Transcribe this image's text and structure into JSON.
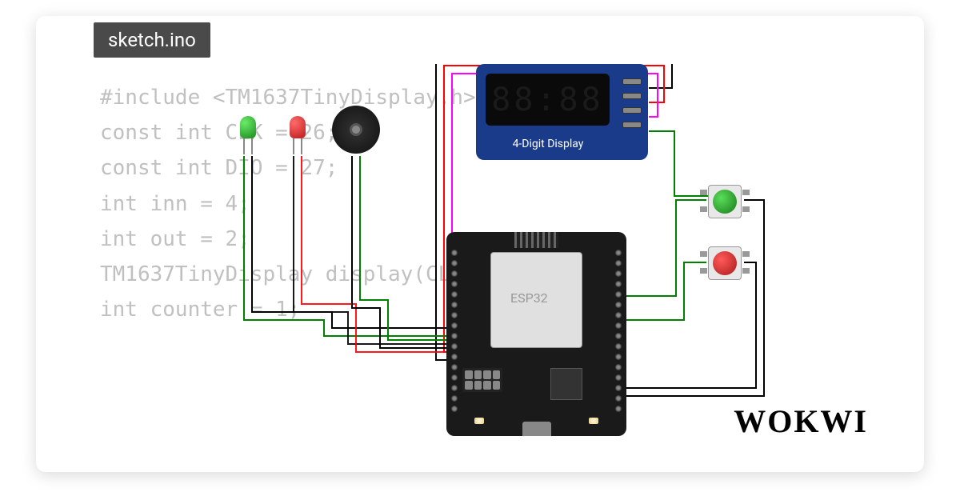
{
  "tab_name": "sketch.ino",
  "logo_text": "WOKWI",
  "code": {
    "line1": "#include <TM1637TinyDisplay.h>",
    "line2": "const int CLK = 26;",
    "line3": "const int DIO = 27;",
    "line4": "",
    "line5": "int inn = 4;",
    "line6": "int out = 2;",
    "line7": "",
    "line8": "TM1637TinyDisplay display(CLK, DIO);",
    "line9": "",
    "line10": "int counter = 1;"
  },
  "components": {
    "display": {
      "name": "4-Digit Display",
      "segments_text": "88:88"
    },
    "mcu_label": "ESP32"
  }
}
